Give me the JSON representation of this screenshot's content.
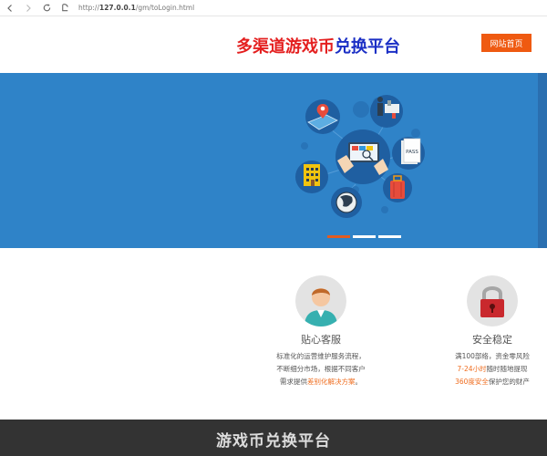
{
  "browser": {
    "address_prefix": "http://",
    "address_host": "127.0.0.1",
    "address_path": "/gm/toLogin.html"
  },
  "header": {
    "title_part1": "多渠道游戏币",
    "title_part2": "兑换平台",
    "home_label": "网站首页"
  },
  "banner": {
    "pass_label": "PASS",
    "slides": 3,
    "active_slide": 1
  },
  "features": {
    "service": {
      "title": "贴心客服",
      "line1": "标准化的运营维护服务流程，",
      "line2": "不断细分市场，根据不同客户",
      "line3_pre": "需求提供",
      "line3_hl": "差别化解决方案",
      "line3_post": "。"
    },
    "security": {
      "title": "安全稳定",
      "line1": "满100部络，资金零风险",
      "line2_hl": "7-24小时",
      "line2_post": "随时随地提现",
      "line3_hl": "360度安全",
      "line3_post": "保护您的财产"
    }
  },
  "footer": {
    "title": "游戏币兑换平台"
  },
  "colors": {
    "banner_blue": "#2f83c8",
    "accent_orange": "#ef5a11",
    "title_red": "#e41f1f",
    "title_blue": "#1b2fc5",
    "footer_dark": "#333333"
  }
}
